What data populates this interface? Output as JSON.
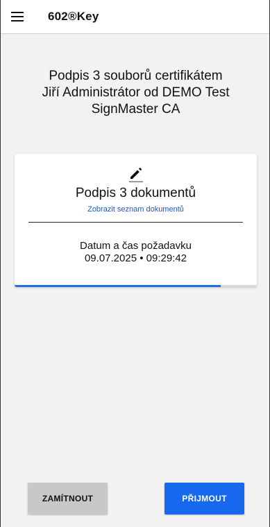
{
  "header": {
    "title": "602®Key"
  },
  "heading": {
    "line1": "Podpis 3 souborů certifikátem",
    "line2": "Jiří Administrátor od DEMO Test",
    "line3": "SignMaster CA"
  },
  "card": {
    "title": "Podpis 3 dokumentů",
    "link": "Zobrazit seznam dokumentů",
    "datetime_label": "Datum a čas požadavku",
    "datetime_value": "09.07.2025 • 09:29:42",
    "progress": 0.85
  },
  "actions": {
    "reject_label": "ZAMÍTNOUT",
    "accept_label": "PŘIJMOUT"
  },
  "icons": {
    "menu": "menu-icon",
    "edit": "pencil-icon"
  },
  "colors": {
    "accent": "#1669ef",
    "link": "#1a56d6",
    "reject_bg": "#c8c8c8"
  }
}
